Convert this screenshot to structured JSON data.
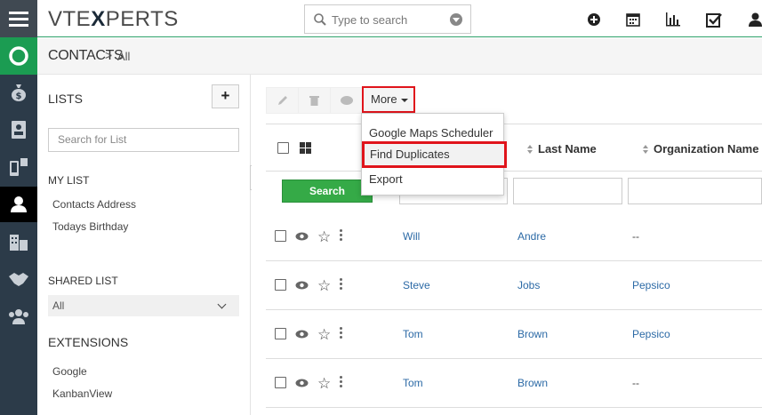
{
  "header": {
    "logo_prefix": "VTE",
    "logo_x": "X",
    "logo_suffix": "PERTS",
    "search_placeholder": "Type to search"
  },
  "breadcrumb": {
    "module": "CONTACTS",
    "separator": ">",
    "view": "All"
  },
  "sidebar": {
    "lists_heading": "LISTS",
    "add_label": "+",
    "search_placeholder": "Search for List",
    "my_list_heading": "MY LIST",
    "my_list_items": [
      "Contacts Address",
      "Todays Birthday"
    ],
    "shared_list_heading": "SHARED LIST",
    "shared_selected": "All",
    "extensions_heading": "EXTENSIONS",
    "extension_items": [
      "Google",
      "KanbanView"
    ]
  },
  "toolbar": {
    "more_label": "More"
  },
  "more_menu": {
    "items": [
      "Google Maps Scheduler",
      "Find Duplicates",
      "Export"
    ]
  },
  "table": {
    "columns": [
      "Last Name",
      "Organization Name"
    ],
    "search_label": "Search",
    "rows": [
      {
        "first": "Will",
        "last": "Andre",
        "org": "--"
      },
      {
        "first": "Steve",
        "last": "Jobs",
        "org": "Pepsico"
      },
      {
        "first": "Tom",
        "last": "Brown",
        "org": "Pepsico"
      },
      {
        "first": "Tom",
        "last": "Brown",
        "org": "--"
      }
    ]
  },
  "colors": {
    "rail": "#2c3b49",
    "accent_green": "#35aa47",
    "highlight_red": "#e0141b",
    "link_blue": "#2c6aa6"
  }
}
